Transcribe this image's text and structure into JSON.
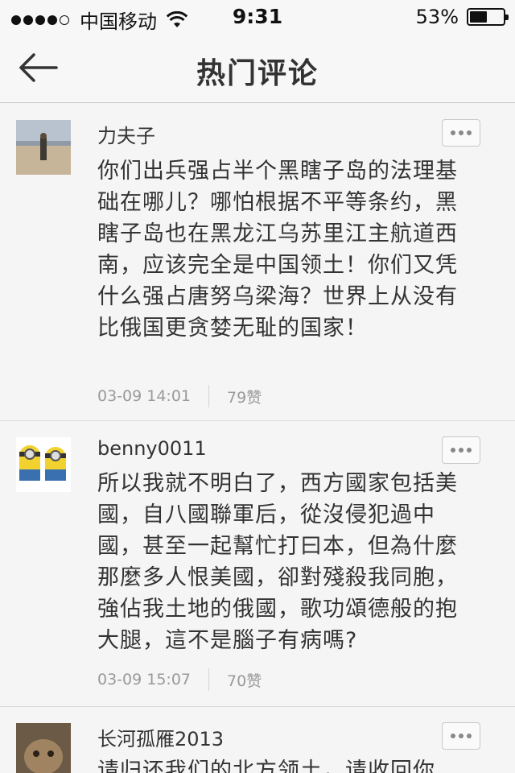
{
  "status": {
    "carrier": "中国移动",
    "time": "9:31",
    "battery_percent": "53%",
    "battery_level": 0.53
  },
  "nav": {
    "title": "热门评论"
  },
  "comments": [
    {
      "author": "力夫子",
      "content": "你们出兵强占半个黑瞎子岛的法理基础在哪儿？哪怕根据不平等条约，黑瞎子岛也在黑龙江乌苏里江主航道西南，应该完全是中国领土！你们又凭什么强占唐努乌梁海？世界上从没有比俄国更贪婪无耻的国家！",
      "time": "03-09 14:01",
      "likes": "79赞",
      "avatar": "beach-photo"
    },
    {
      "author": "benny0011",
      "content": "所以我就不明白了，西方國家包括美國，自八國聯軍后，從沒侵犯過中國，甚至一起幫忙打曰本，但為什麼那麼多人恨美國，卻對殘殺我同胞，強佔我土地的俄國，歌功頌德般的抱大腿，這不是腦子有病嗎?",
      "time": "03-09 15:07",
      "likes": "70赞",
      "avatar": "minions"
    },
    {
      "author": "长河孤雁2013",
      "content": "请归还我们的北方领土，请收回你",
      "time": "",
      "likes": "",
      "avatar": "cat-photo"
    }
  ],
  "icons": {
    "back": "back-arrow-icon",
    "more": "more-icon",
    "wifi": "wifi-icon",
    "signal": "signal-icon",
    "battery": "battery-icon"
  }
}
